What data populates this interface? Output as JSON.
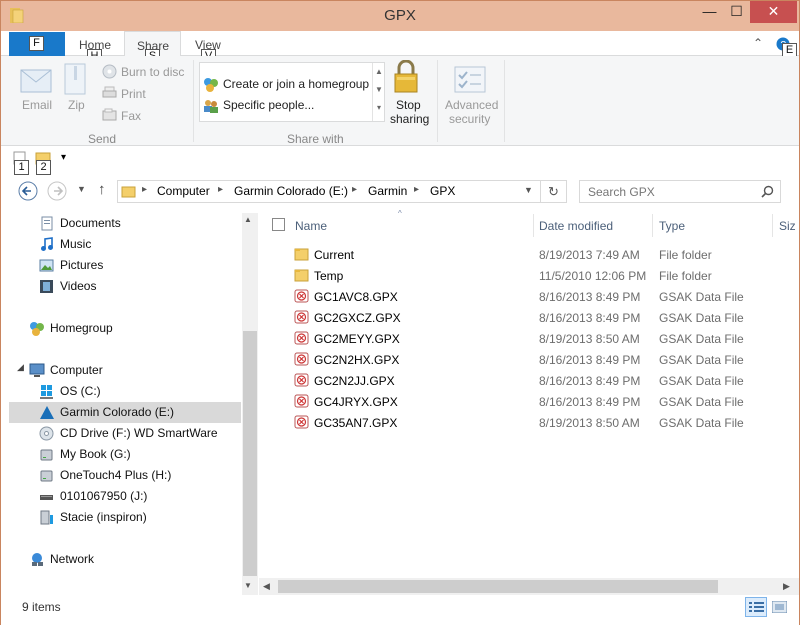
{
  "window": {
    "title": "GPX",
    "minimize": "—",
    "maximize": "☐",
    "close": "✕"
  },
  "tabs": {
    "file": "F",
    "home": "Home",
    "share": "Share",
    "view": "View"
  },
  "keytips": {
    "file": "F",
    "home": "H",
    "share": "S",
    "view": "V",
    "expand": "E",
    "qat1": "1",
    "qat2": "2"
  },
  "ribbon": {
    "send": {
      "group": "Send",
      "email": "Email",
      "zip": "Zip",
      "burn": "Burn to disc",
      "print": "Print",
      "fax": "Fax"
    },
    "share_with": {
      "group": "Share with",
      "homegroup": "Create or join a homegroup",
      "specific": "Specific people...",
      "stop1": "Stop",
      "stop2": "sharing",
      "adv1": "Advanced",
      "adv2": "security"
    }
  },
  "nav": {
    "breadcrumb": [
      "Computer",
      "Garmin Colorado (E:)",
      "Garmin",
      "GPX"
    ],
    "search_placeholder": "Search GPX"
  },
  "sidebar": [
    {
      "label": "Documents",
      "icon": "documents-icon"
    },
    {
      "label": "Music",
      "icon": "music-icon"
    },
    {
      "label": "Pictures",
      "icon": "pictures-icon"
    },
    {
      "label": "Videos",
      "icon": "videos-icon"
    },
    {
      "label": "Homegroup",
      "icon": "homegroup-icon"
    },
    {
      "label": "Computer",
      "icon": "computer-icon"
    },
    {
      "label": "OS (C:)",
      "icon": "windows-drive-icon"
    },
    {
      "label": "Garmin Colorado (E:)",
      "icon": "garmin-drive-icon"
    },
    {
      "label": "CD Drive (F:) WD SmartWare",
      "icon": "cd-drive-icon"
    },
    {
      "label": "My Book (G:)",
      "icon": "drive-icon"
    },
    {
      "label": "OneTouch4 Plus (H:)",
      "icon": "drive-icon"
    },
    {
      "label": "0101067950 (J:)",
      "icon": "usb-drive-icon"
    },
    {
      "label": "Stacie (inspiron)",
      "icon": "network-computer-icon"
    },
    {
      "label": "Network",
      "icon": "network-icon"
    }
  ],
  "columns": {
    "name": "Name",
    "date": "Date modified",
    "type": "Type",
    "size": "Siz"
  },
  "files": [
    {
      "name": "Current",
      "date": "8/19/2013 7:49 AM",
      "type": "File folder",
      "kind": "folder"
    },
    {
      "name": "Temp",
      "date": "11/5/2010 12:06 PM",
      "type": "File folder",
      "kind": "folder"
    },
    {
      "name": "GC1AVC8.GPX",
      "date": "8/16/2013 8:49 PM",
      "type": "GSAK Data File",
      "kind": "file"
    },
    {
      "name": "GC2GXCZ.GPX",
      "date": "8/16/2013 8:49 PM",
      "type": "GSAK Data File",
      "kind": "file"
    },
    {
      "name": "GC2MEYY.GPX",
      "date": "8/19/2013 8:50 AM",
      "type": "GSAK Data File",
      "kind": "file"
    },
    {
      "name": "GC2N2HX.GPX",
      "date": "8/16/2013 8:49 PM",
      "type": "GSAK Data File",
      "kind": "file"
    },
    {
      "name": "GC2N2JJ.GPX",
      "date": "8/16/2013 8:49 PM",
      "type": "GSAK Data File",
      "kind": "file"
    },
    {
      "name": "GC4JRYX.GPX",
      "date": "8/16/2013 8:49 PM",
      "type": "GSAK Data File",
      "kind": "file"
    },
    {
      "name": "GC35AN7.GPX",
      "date": "8/19/2013 8:50 AM",
      "type": "GSAK Data File",
      "kind": "file"
    }
  ],
  "status": {
    "items": "9 items"
  },
  "colors": {
    "accent": "#1979ca",
    "titlebar": "#e9b89d",
    "close": "#c75050",
    "selected": "#d9d9d9"
  }
}
